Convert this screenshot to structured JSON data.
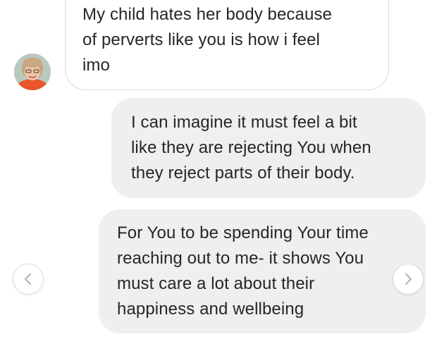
{
  "messages": [
    {
      "sender": "other",
      "lines": [
        "My child hates her body because",
        "of perverts like you is how i feel",
        "imo"
      ]
    },
    {
      "sender": "self",
      "lines": [
        "I can imagine it must feel a bit",
        "like they are rejecting You when",
        "they reject parts of their body."
      ]
    },
    {
      "sender": "self",
      "lines": [
        "For You to be spending Your time",
        "reaching out to me- it shows You",
        "must care a lot about their",
        "happiness and wellbeing"
      ]
    }
  ],
  "icons": {
    "prev": "chevron-left-icon",
    "next": "chevron-right-icon"
  },
  "colors": {
    "received_bubble_bg": "#ffffff",
    "received_bubble_border": "#dbdbdb",
    "sent_bubble_bg": "#efefef",
    "text": "#262626",
    "arrow": "#b5b5b5"
  }
}
